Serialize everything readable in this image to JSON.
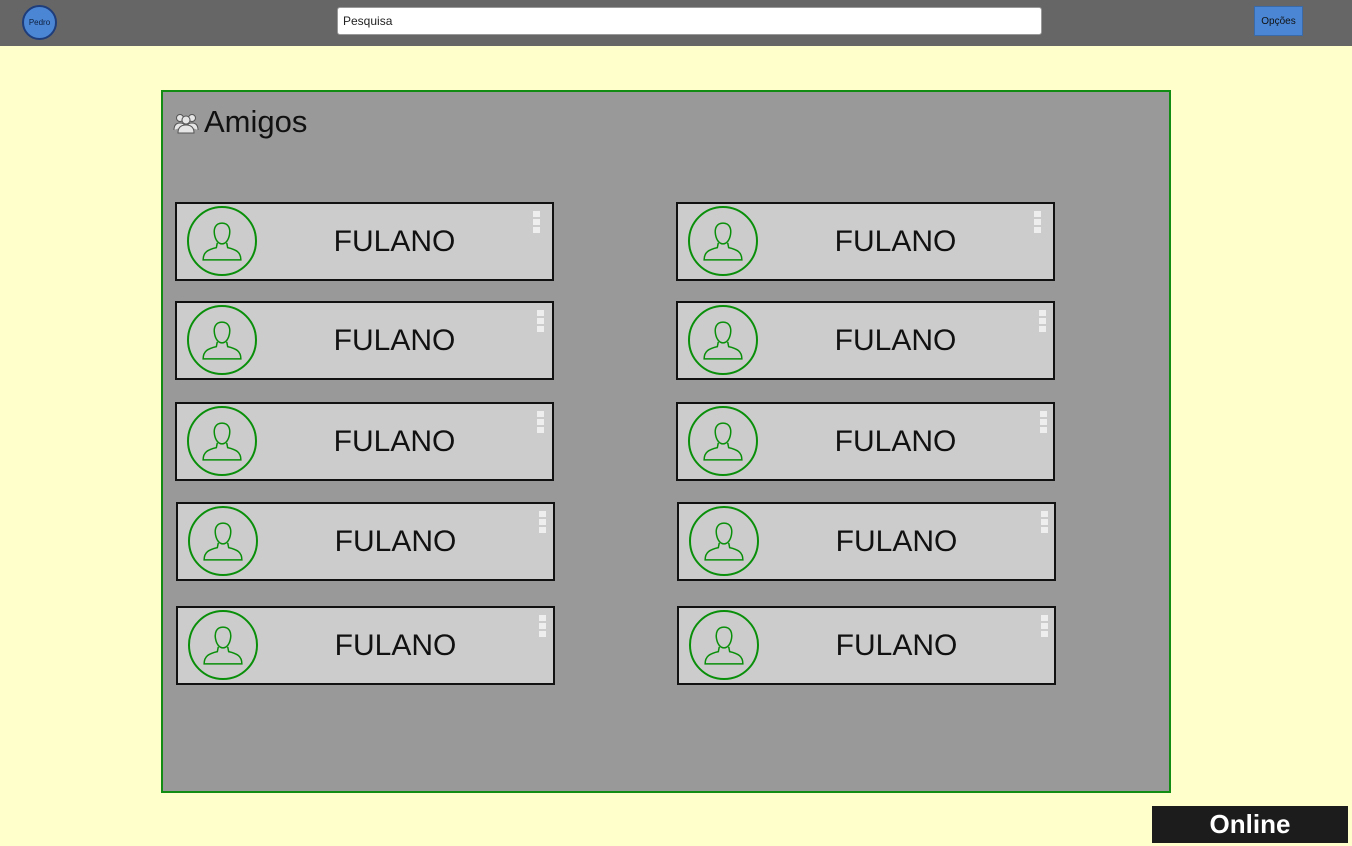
{
  "topbar": {
    "user_name": "Pedro",
    "search": {
      "placeholder": "Pesquisa",
      "value": ""
    },
    "options_label": "Opções"
  },
  "friends_panel": {
    "title": "Amigos",
    "icon": "group-icon",
    "friends": [
      {
        "name": "FULANO"
      },
      {
        "name": "FULANO"
      },
      {
        "name": "FULANO"
      },
      {
        "name": "FULANO"
      },
      {
        "name": "FULANO"
      },
      {
        "name": "FULANO"
      },
      {
        "name": "FULANO"
      },
      {
        "name": "FULANO"
      },
      {
        "name": "FULANO"
      },
      {
        "name": "FULANO"
      }
    ]
  },
  "status": {
    "label": "Online"
  },
  "colors": {
    "page_background": "#ffffcc",
    "topbar": "#666666",
    "accent_blue": "#4a86d4",
    "panel": "#999999",
    "panel_border": "#138c13",
    "avatar_outline": "#0a8f0a",
    "card": "#cccccc",
    "status_bar": "#1c1c1c"
  }
}
